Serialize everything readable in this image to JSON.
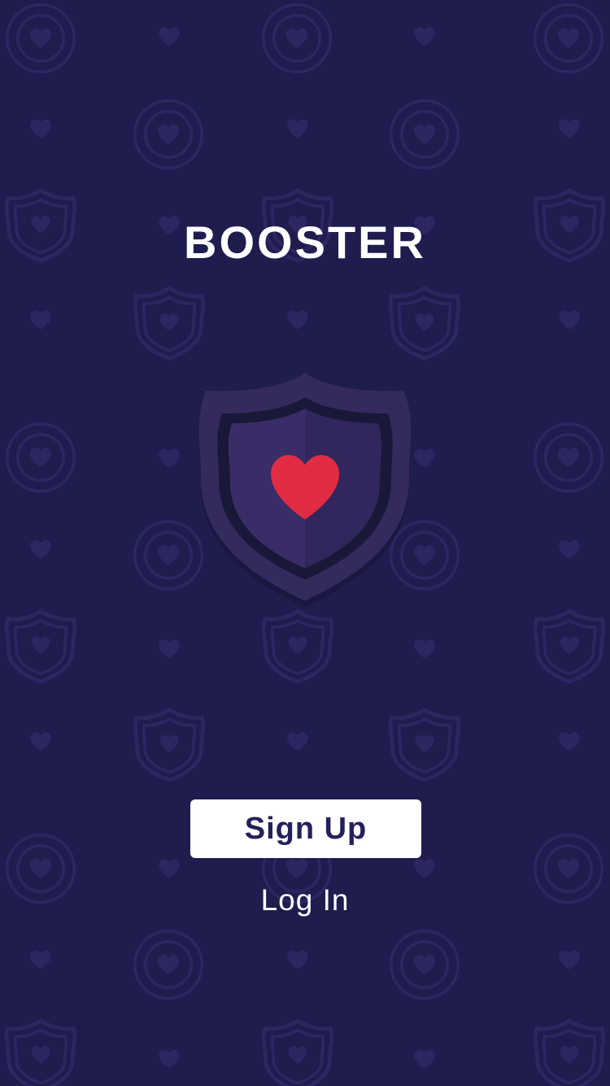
{
  "app": {
    "title": "BOOSTER"
  },
  "actions": {
    "signup_label": "Sign Up",
    "login_label": "Log In"
  },
  "colors": {
    "background": "#1f1c4e",
    "pattern": "#2c2761",
    "shield_outer": "#342a5e",
    "shield_dark_line": "#1a1838",
    "shield_light_half": "#3a2c67",
    "shield_dark_half": "#31275c",
    "heart": "#e12c43",
    "button": "#ffffff",
    "button_text": "#24215a"
  },
  "icons": {
    "logo": "shield-heart-icon",
    "background_pattern": [
      "shield-heart-icon",
      "ring-heart-icon",
      "heart-icon"
    ]
  }
}
